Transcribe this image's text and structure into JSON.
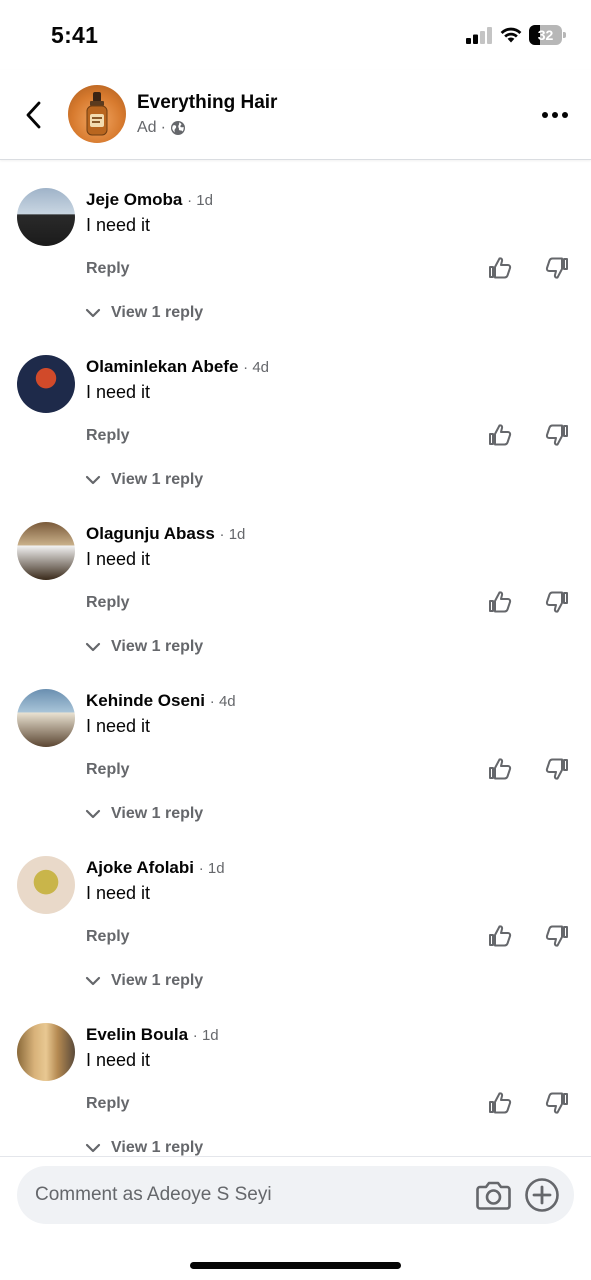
{
  "status_bar": {
    "time": "5:41",
    "battery": "32",
    "battery_fraction": 0.32
  },
  "header": {
    "page_name": "Everything Hair",
    "subtitle": "Ad"
  },
  "comments": [
    {
      "name": "Jeje Omoba",
      "time": "1d",
      "text": "I need it",
      "reply_label": "Reply",
      "view_replies": "View 1 reply"
    },
    {
      "name": "Olaminlekan Abefe",
      "time": "4d",
      "text": "I need it",
      "reply_label": "Reply",
      "view_replies": "View 1 reply"
    },
    {
      "name": "Olagunju Abass",
      "time": "1d",
      "text": "I need it",
      "reply_label": "Reply",
      "view_replies": "View 1 reply"
    },
    {
      "name": "Kehinde Oseni",
      "time": "4d",
      "text": "I need it",
      "reply_label": "Reply",
      "view_replies": "View 1 reply"
    },
    {
      "name": "Ajoke Afolabi",
      "time": "1d",
      "text": "I need it",
      "reply_label": "Reply",
      "view_replies": "View 1 reply"
    },
    {
      "name": "Evelin Boula",
      "time": "1d",
      "text": "I need it",
      "reply_label": "Reply",
      "view_replies": "View 1 reply"
    }
  ],
  "composer": {
    "placeholder": "Comment as Adeoye S Seyi"
  },
  "colors": {
    "text_primary": "#050505",
    "text_secondary": "#65676b",
    "input_bg": "#f0f2f5"
  }
}
